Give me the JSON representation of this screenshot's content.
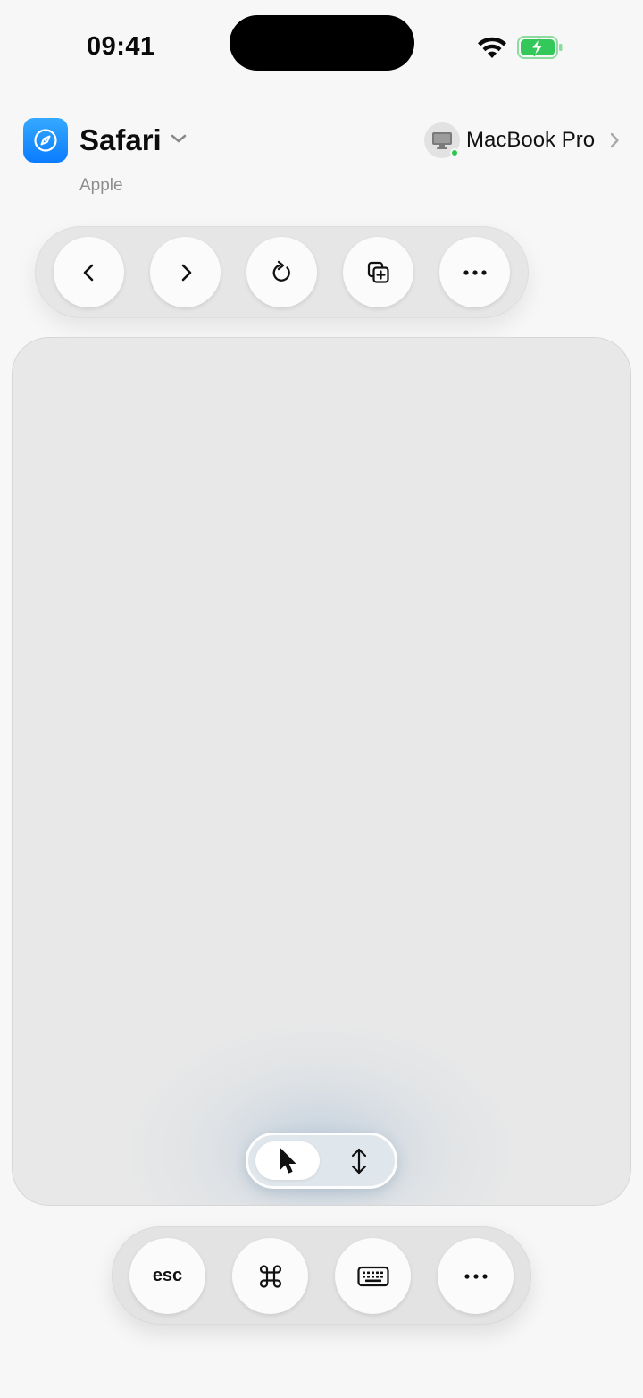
{
  "status_bar": {
    "time": "09:41",
    "battery_icon": "battery-charging-icon",
    "wifi_icon": "wifi-icon",
    "battery_color": "#34c759"
  },
  "header": {
    "app_name": "Safari",
    "app_vendor": "Apple",
    "app_icon": "safari-compass-icon",
    "app_icon_color": "#1a8cff",
    "device_name": "MacBook Pro",
    "device_icon": "monitor-icon",
    "device_status_color": "#2ec54b"
  },
  "toolbar_top": {
    "buttons": [
      {
        "name": "back",
        "icon": "chevron-left-icon"
      },
      {
        "name": "forward",
        "icon": "chevron-right-icon"
      },
      {
        "name": "reload",
        "icon": "reload-icon"
      },
      {
        "name": "new-tab",
        "icon": "add-tab-icon"
      },
      {
        "name": "more",
        "icon": "ellipsis-icon"
      }
    ]
  },
  "trackpad": {
    "modes": [
      {
        "name": "pointer",
        "icon": "cursor-arrow-icon",
        "selected": true
      },
      {
        "name": "scroll",
        "icon": "vertical-scroll-icon",
        "selected": false
      }
    ]
  },
  "toolbar_bottom": {
    "esc_label": "esc",
    "buttons": [
      {
        "name": "escape",
        "label": "esc"
      },
      {
        "name": "command",
        "icon": "command-icon"
      },
      {
        "name": "keyboard",
        "icon": "keyboard-icon"
      },
      {
        "name": "more",
        "icon": "ellipsis-icon"
      }
    ]
  }
}
